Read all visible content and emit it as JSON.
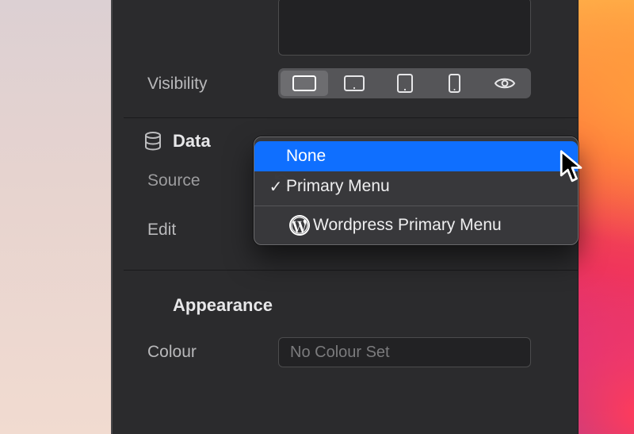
{
  "visibility": {
    "label": "Visibility",
    "segments": [
      {
        "name": "desktop",
        "active": true
      },
      {
        "name": "tablet-landscape",
        "active": false
      },
      {
        "name": "tablet-portrait",
        "active": false
      },
      {
        "name": "phone",
        "active": false
      },
      {
        "name": "preview",
        "active": false
      }
    ]
  },
  "data_section": {
    "title": "Data",
    "source_label": "Source",
    "edit_label": "Edit",
    "dropdown": {
      "highlighted": "None",
      "items": [
        {
          "label": "None",
          "highlighted": true,
          "checked": false
        },
        {
          "label": "Primary Menu",
          "highlighted": false,
          "checked": true
        }
      ],
      "platform_items": [
        {
          "label": "Wordpress Primary Menu",
          "icon": "wordpress"
        }
      ]
    }
  },
  "appearance_section": {
    "title": "Appearance",
    "colour_label": "Colour",
    "colour_placeholder": "No Colour Set"
  }
}
